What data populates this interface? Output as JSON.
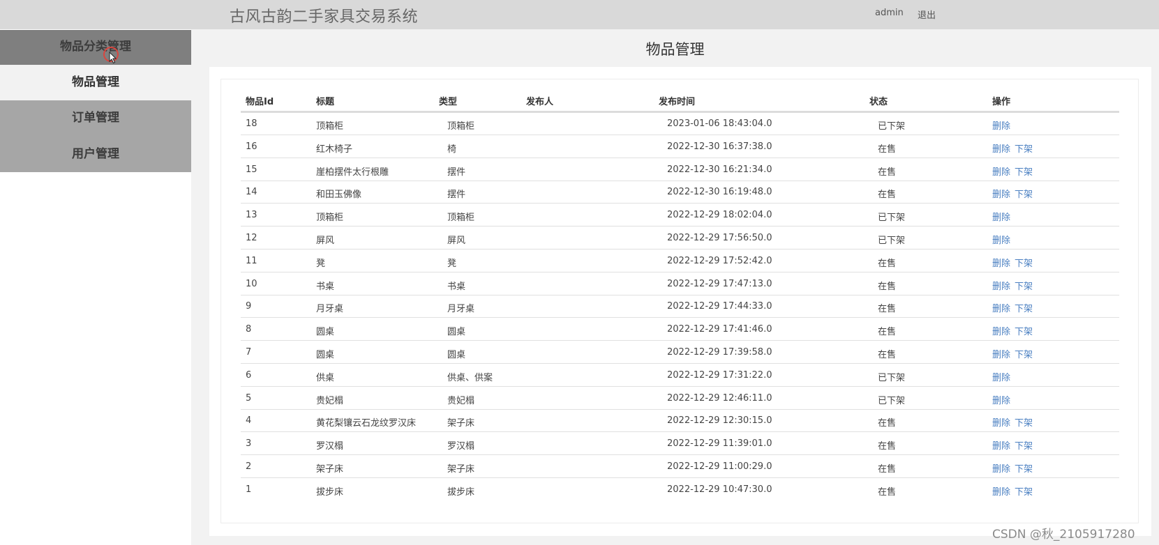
{
  "header": {
    "title": "古风古韵二手家具交易系统",
    "user": "admin",
    "logout": "退出"
  },
  "sidebar": {
    "items": [
      {
        "label": "物品分类管理"
      },
      {
        "label": "物品管理"
      },
      {
        "label": "订单管理"
      },
      {
        "label": "用户管理"
      }
    ]
  },
  "page": {
    "heading": "物品管理"
  },
  "table": {
    "columns": [
      "物品Id",
      "标题",
      "类型",
      "发布人",
      "发布时间",
      "状态",
      "操作"
    ],
    "rows": [
      {
        "id": "18",
        "title": "顶箱柜",
        "type": "顶箱柜",
        "publisher": "",
        "time": "2023-01-06 18:43:04.0",
        "status": "已下架",
        "actions": [
          "删除"
        ]
      },
      {
        "id": "16",
        "title": "红木椅子",
        "type": "椅",
        "publisher": "",
        "time": "2022-12-30 16:37:38.0",
        "status": "在售",
        "actions": [
          "删除",
          "下架"
        ]
      },
      {
        "id": "15",
        "title": "崖柏摆件太行根雕",
        "type": "摆件",
        "publisher": "",
        "time": "2022-12-30 16:21:34.0",
        "status": "在售",
        "actions": [
          "删除",
          "下架"
        ]
      },
      {
        "id": "14",
        "title": "和田玉佛像",
        "type": "摆件",
        "publisher": "",
        "time": "2022-12-30 16:19:48.0",
        "status": "在售",
        "actions": [
          "删除",
          "下架"
        ]
      },
      {
        "id": "13",
        "title": "顶箱柜",
        "type": "顶箱柜",
        "publisher": "",
        "time": "2022-12-29 18:02:04.0",
        "status": "已下架",
        "actions": [
          "删除"
        ]
      },
      {
        "id": "12",
        "title": "屏风",
        "type": "屏风",
        "publisher": "",
        "time": "2022-12-29 17:56:50.0",
        "status": "已下架",
        "actions": [
          "删除"
        ]
      },
      {
        "id": "11",
        "title": "凳",
        "type": "凳",
        "publisher": "",
        "time": "2022-12-29 17:52:42.0",
        "status": "在售",
        "actions": [
          "删除",
          "下架"
        ]
      },
      {
        "id": "10",
        "title": "书桌",
        "type": "书桌",
        "publisher": "",
        "time": "2022-12-29 17:47:13.0",
        "status": "在售",
        "actions": [
          "删除",
          "下架"
        ]
      },
      {
        "id": "9",
        "title": "月牙桌",
        "type": "月牙桌",
        "publisher": "",
        "time": "2022-12-29 17:44:33.0",
        "status": "在售",
        "actions": [
          "删除",
          "下架"
        ]
      },
      {
        "id": "8",
        "title": "圆桌",
        "type": "圆桌",
        "publisher": "",
        "time": "2022-12-29 17:41:46.0",
        "status": "在售",
        "actions": [
          "删除",
          "下架"
        ]
      },
      {
        "id": "7",
        "title": "圆桌",
        "type": "圆桌",
        "publisher": "",
        "time": "2022-12-29 17:39:58.0",
        "status": "在售",
        "actions": [
          "删除",
          "下架"
        ]
      },
      {
        "id": "6",
        "title": "供桌",
        "type": "供桌、供案",
        "publisher": "",
        "time": "2022-12-29 17:31:22.0",
        "status": "已下架",
        "actions": [
          "删除"
        ]
      },
      {
        "id": "5",
        "title": "贵妃榻",
        "type": "贵妃榻",
        "publisher": "",
        "time": "2022-12-29 12:46:11.0",
        "status": "已下架",
        "actions": [
          "删除"
        ]
      },
      {
        "id": "4",
        "title": "黄花梨镶云石龙纹罗汉床",
        "type": "架子床",
        "publisher": "",
        "time": "2022-12-29 12:30:15.0",
        "status": "在售",
        "actions": [
          "删除",
          "下架"
        ]
      },
      {
        "id": "3",
        "title": "罗汉榻",
        "type": "罗汉榻",
        "publisher": "",
        "time": "2022-12-29 11:39:01.0",
        "status": "在售",
        "actions": [
          "删除",
          "下架"
        ]
      },
      {
        "id": "2",
        "title": "架子床",
        "type": "架子床",
        "publisher": "",
        "time": "2022-12-29 11:00:29.0",
        "status": "在售",
        "actions": [
          "删除",
          "下架"
        ]
      },
      {
        "id": "1",
        "title": "拔步床",
        "type": "拔步床",
        "publisher": "",
        "time": "2022-12-29 10:47:30.0",
        "status": "在售",
        "actions": [
          "删除",
          "下架"
        ]
      }
    ]
  },
  "watermark": "CSDN @秋_2105917280",
  "colors": {
    "link": "#4a7fc1",
    "topbar": "#d9d9d9",
    "sidebar_active": "#7f7f7f",
    "sidebar_item": "#a6a6a6"
  }
}
